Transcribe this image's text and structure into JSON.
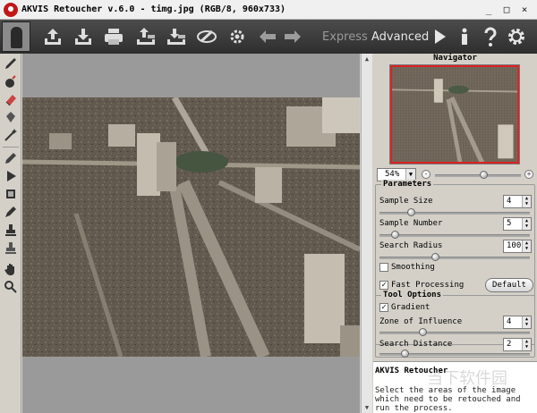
{
  "window": {
    "title": "AKVIS Retoucher v.6.0 - timg.jpg (RGB/8, 960x733)",
    "controls": [
      "_",
      "□",
      "×"
    ]
  },
  "toolbar": {
    "buttons": [
      {
        "name": "open-icon"
      },
      {
        "name": "save-icon"
      },
      {
        "name": "print-icon"
      },
      {
        "name": "import-selection-icon"
      },
      {
        "name": "export-selection-icon"
      },
      {
        "name": "settings-brush-icon"
      },
      {
        "name": "preferences-icon"
      },
      {
        "name": "undo-arrow-icon"
      },
      {
        "name": "redo-arrow-icon"
      }
    ],
    "mode_express": "Express",
    "mode_advanced": "Advanced",
    "run_icon": "play-icon",
    "info_icon": "info-icon",
    "help_icon": "help-icon",
    "options_icon": "gear-icon"
  },
  "left_tools": [
    "brush-icon",
    "bomb-icon",
    "eraser-icon",
    "bucket-icon",
    "magic-wand-icon",
    "chisel-icon",
    "run-icon",
    "stamp-icon",
    "pen-icon",
    "clone-stamp-icon",
    "patch-icon",
    "hand-icon",
    "zoom-icon"
  ],
  "navigator": {
    "title": "Navigator",
    "zoom": "54%",
    "zoom_minus": "-",
    "zoom_plus": "+",
    "zoom_slider_level": 0.55
  },
  "parameters": {
    "title": "Parameters",
    "sample_size": {
      "label": "Sample Size",
      "value": "4"
    },
    "sample_number": {
      "label": "Sample Number",
      "value": "5"
    },
    "search_radius": {
      "label": "Search Radius",
      "value": "100"
    },
    "smoothing": {
      "label": "Smoothing",
      "checked": false
    },
    "fast_processing": {
      "label": "Fast Processing",
      "checked": true
    },
    "default_button": "Default"
  },
  "tool_options": {
    "title": "Tool Options",
    "gradient": {
      "label": "Gradient",
      "checked": true
    },
    "zone_of_influence": {
      "label": "Zone of Influence",
      "value": "4"
    },
    "search_distance": {
      "label": "Search Distance",
      "value": "2"
    }
  },
  "info": {
    "title": "AKVIS Retoucher",
    "text": "Select the areas of the image which need to be retouched and run the process.",
    "watermark": "当下软件园"
  },
  "check_mark": "✓"
}
